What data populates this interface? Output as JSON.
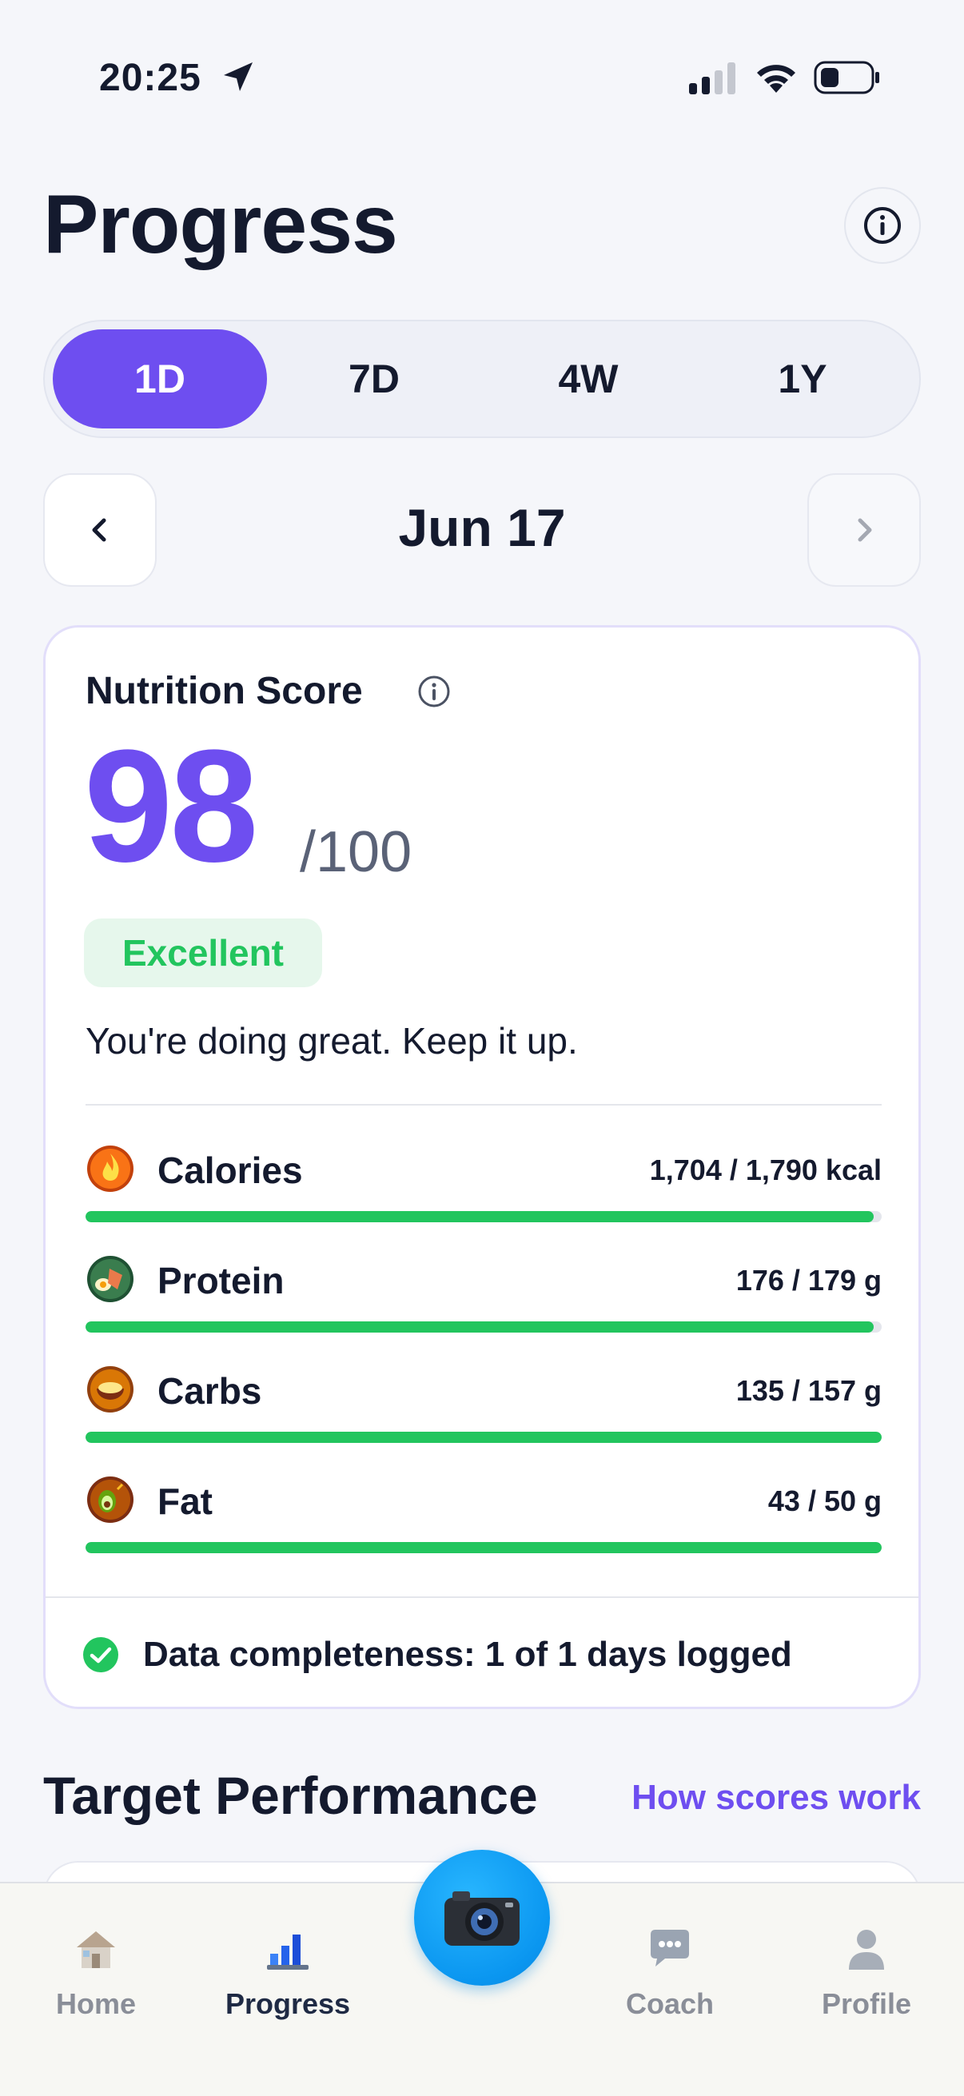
{
  "status_bar": {
    "time": "20:25",
    "icons": [
      "location-arrow-icon",
      "cellular-signal-icon",
      "wifi-icon",
      "battery-icon"
    ]
  },
  "header": {
    "title": "Progress",
    "info_icon": "info-icon"
  },
  "range_tabs": [
    {
      "label": "1D",
      "active": true
    },
    {
      "label": "7D",
      "active": false
    },
    {
      "label": "4W",
      "active": false
    },
    {
      "label": "1Y",
      "active": false
    }
  ],
  "date_nav": {
    "label": "Jun 17",
    "prev_icon": "chevron-left-icon",
    "next_icon": "chevron-right-icon"
  },
  "nutrition_score": {
    "title": "Nutrition Score",
    "score": "98",
    "max": "/100",
    "badge": "Excellent",
    "message": "You're doing great. Keep it up.",
    "macros": [
      {
        "name": "Calories",
        "value": "1,704 / 1,790 kcal",
        "progress": 0.99,
        "icon": "fire-icon"
      },
      {
        "name": "Protein",
        "value": "176 / 179 g",
        "progress": 0.99,
        "icon": "protein-food-icon"
      },
      {
        "name": "Carbs",
        "value": "135 / 157 g",
        "progress": 1.0,
        "icon": "grain-bowl-icon"
      },
      {
        "name": "Fat",
        "value": "43 / 50 g",
        "progress": 1.0,
        "icon": "avocado-icon"
      }
    ],
    "completeness": "Data completeness: 1 of 1 days logged"
  },
  "target_performance": {
    "title": "Target Performance",
    "link": "How scores work"
  },
  "tab_bar": {
    "items": [
      {
        "label": "Home",
        "icon": "home-icon",
        "active": false
      },
      {
        "label": "Progress",
        "icon": "bar-chart-icon",
        "active": true
      },
      {
        "label": "Coach",
        "icon": "chat-bubble-icon",
        "active": false
      },
      {
        "label": "Profile",
        "icon": "person-icon",
        "active": false
      }
    ],
    "camera_icon": "camera-icon"
  },
  "colors": {
    "accent": "#6e4ef0",
    "success": "#22c55e",
    "background": "#f5f6fa"
  }
}
